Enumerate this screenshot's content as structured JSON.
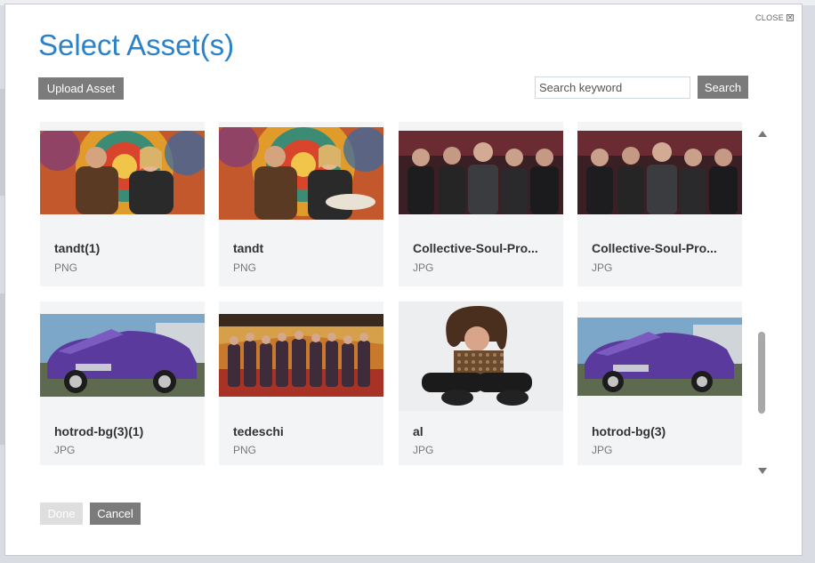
{
  "dialog": {
    "title": "Select Asset(s)",
    "close_label": "CLOSE"
  },
  "toolbar": {
    "upload_label": "Upload Asset",
    "search_placeholder": "Search keyword",
    "search_label": "Search"
  },
  "assets": [
    {
      "name": "tandt(1)",
      "type": "PNG"
    },
    {
      "name": "tandt",
      "type": "PNG"
    },
    {
      "name": "Collective-Soul-Pro...",
      "type": "JPG"
    },
    {
      "name": "Collective-Soul-Pro...",
      "type": "JPG"
    },
    {
      "name": "hotrod-bg(3)(1)",
      "type": "JPG"
    },
    {
      "name": "tedeschi",
      "type": "PNG"
    },
    {
      "name": "al",
      "type": "JPG"
    },
    {
      "name": "hotrod-bg(3)",
      "type": "JPG"
    }
  ],
  "footer": {
    "done_label": "Done",
    "cancel_label": "Cancel"
  }
}
